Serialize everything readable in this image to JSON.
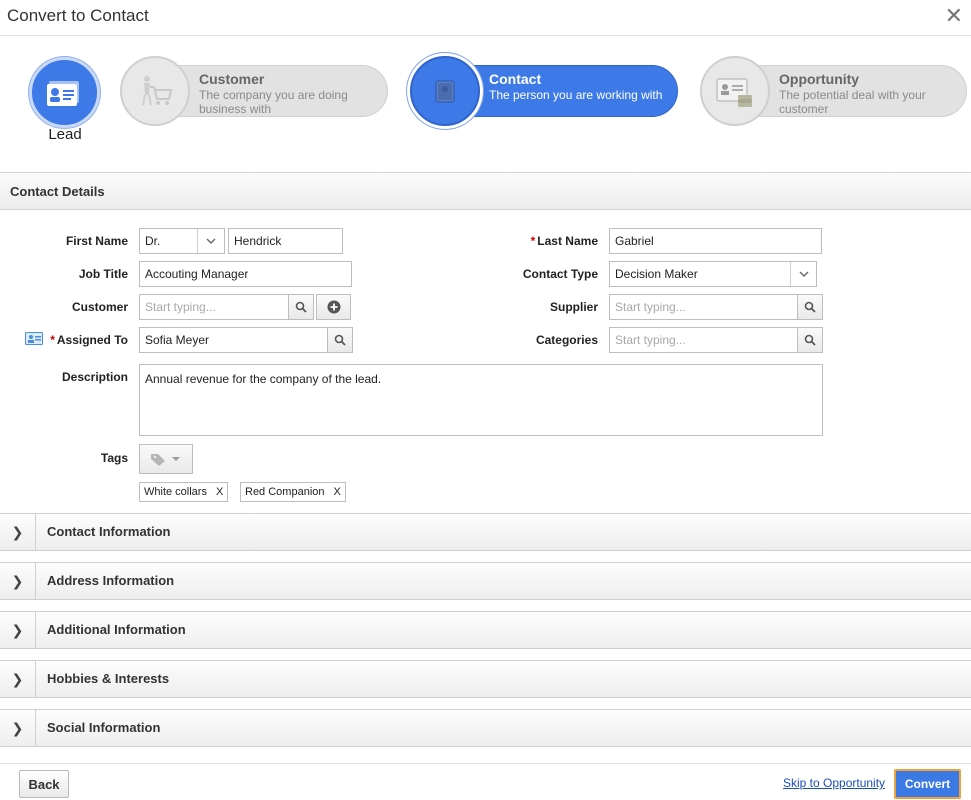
{
  "dialog": {
    "title": "Convert to Contact",
    "close_glyph": "✕"
  },
  "steps": {
    "lead": {
      "label": "Lead"
    },
    "customer": {
      "title": "Customer",
      "desc": "The company you are doing business with"
    },
    "contact": {
      "title": "Contact",
      "desc": "The person you are working with"
    },
    "opportunity": {
      "title": "Opportunity",
      "desc": "The potential deal with your customer"
    }
  },
  "contact_details": {
    "section_title": "Contact Details",
    "first_name": {
      "label": "First Name",
      "salutation": "Dr.",
      "value": "Hendrick"
    },
    "last_name": {
      "label": "Last Name",
      "required_mark": "*",
      "value": "Gabriel"
    },
    "job_title": {
      "label": "Job Title",
      "value": "Accouting Manager"
    },
    "contact_type": {
      "label": "Contact Type",
      "value": "Decision Maker"
    },
    "customer": {
      "label": "Customer",
      "placeholder": "Start typing..."
    },
    "supplier": {
      "label": "Supplier",
      "placeholder": "Start typing..."
    },
    "assigned_to": {
      "label": "Assigned To",
      "required_mark": "*",
      "value": "Sofia Meyer"
    },
    "categories": {
      "label": "Categories",
      "placeholder": "Start typing..."
    },
    "description": {
      "label": "Description",
      "value": "Annual revenue for the company of the lead."
    },
    "tags": {
      "label": "Tags",
      "items": [
        "White collars",
        "Red Companion"
      ],
      "remove_glyph": "X"
    }
  },
  "collapsible_sections": [
    {
      "label": "Contact Information",
      "chevron": "❯"
    },
    {
      "label": "Address Information",
      "chevron": "❯"
    },
    {
      "label": "Additional Information",
      "chevron": "❯"
    },
    {
      "label": "Hobbies & Interests",
      "chevron": "❯"
    },
    {
      "label": "Social Information",
      "chevron": "❯"
    }
  ],
  "footer": {
    "back_label": "Back",
    "skip_label": "Skip to Opportunity",
    "convert_label": "Convert"
  },
  "colors": {
    "accent": "#3d7ae8",
    "convert_outline": "#f0a23a",
    "required": "#cc0000",
    "link": "#1b4fb8"
  },
  "icons": [
    "close-icon",
    "lead-card-icon",
    "customer-cart-icon",
    "contact-book-icon",
    "opportunity-money-icon",
    "dropdown-arrow-icon",
    "search-icon",
    "add-circle-icon",
    "contact-card-icon",
    "tag-icon",
    "chevron-right-icon"
  ]
}
